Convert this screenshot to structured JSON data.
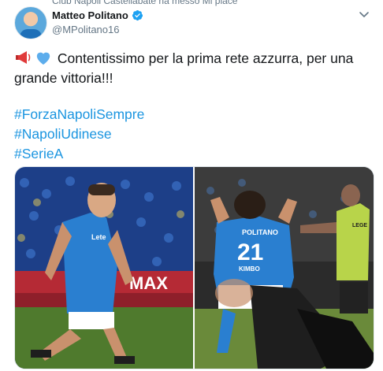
{
  "social_context": "Club Napoli Castellabate ha messo Mi piace",
  "author": {
    "display_name": "Matteo Politano",
    "handle": "@MPolitano16",
    "verified": true,
    "avatar_icon": "profile-avatar"
  },
  "tweet": {
    "emojis": [
      "megaphone-icon",
      "blue-heart-icon"
    ],
    "text": "Contentissimo per la prima rete azzurra, per una grande vittoria!!!",
    "hashtags": [
      "#ForzaNapoliSempre",
      "#NapoliUdinese",
      "#SerieA"
    ]
  },
  "media": {
    "photo1": {
      "jersey_brand": "Lete",
      "sponsor_board": "MAX"
    },
    "photo2": {
      "jersey_name": "POLITANO",
      "jersey_number": "21",
      "jersey_sponsor": "KIMBO",
      "referee_badge": "LEGE"
    }
  },
  "colors": {
    "link": "#1b95e0",
    "napoli_blue": "#2a7fd0",
    "pitch": "#4f7a2d"
  }
}
